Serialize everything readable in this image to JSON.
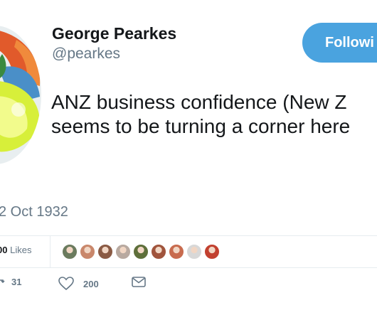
{
  "tweet": {
    "author": {
      "display_name": "George Pearkes",
      "handle": "@pearkes"
    },
    "follow_button_label": "Followi",
    "text": "ANZ business confidence (New Z\nseems to be turning a corner here",
    "timestamp": "2 Oct 1932"
  },
  "stats": {
    "likes_count": "00",
    "likes_label": "Likes",
    "liker_avatar_count": 9
  },
  "actions": {
    "retweet_count": "31",
    "like_count": "200",
    "reply_icon": "reply-icon",
    "retweet_icon": "retweet-icon",
    "like_icon": "heart-icon",
    "dm_icon": "envelope-icon"
  },
  "colors": {
    "follow_button": "#4aa3df",
    "secondary_text": "#657786",
    "divider": "#e6ecf0",
    "liker_avatars": [
      "#6b7b5e",
      "#c9876b",
      "#8a5a44",
      "#b8a9a0",
      "#5e6f3a",
      "#a0543c",
      "#c86b4e",
      "#d8d8d8",
      "#c2402f"
    ]
  }
}
